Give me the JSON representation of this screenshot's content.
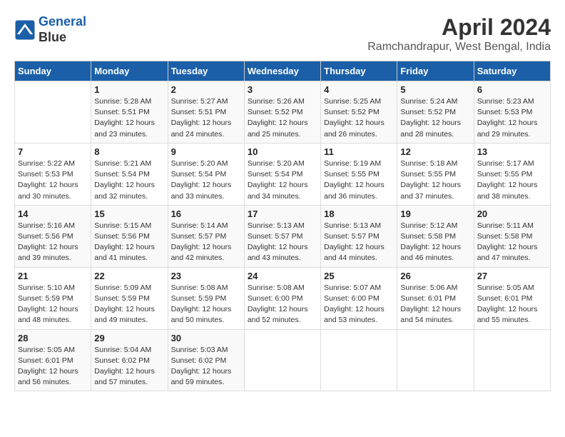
{
  "header": {
    "logo_line1": "General",
    "logo_line2": "Blue",
    "month_year": "April 2024",
    "location": "Ramchandrapur, West Bengal, India"
  },
  "weekdays": [
    "Sunday",
    "Monday",
    "Tuesday",
    "Wednesday",
    "Thursday",
    "Friday",
    "Saturday"
  ],
  "weeks": [
    [
      {
        "day": "",
        "info": ""
      },
      {
        "day": "1",
        "info": "Sunrise: 5:28 AM\nSunset: 5:51 PM\nDaylight: 12 hours\nand 23 minutes."
      },
      {
        "day": "2",
        "info": "Sunrise: 5:27 AM\nSunset: 5:51 PM\nDaylight: 12 hours\nand 24 minutes."
      },
      {
        "day": "3",
        "info": "Sunrise: 5:26 AM\nSunset: 5:52 PM\nDaylight: 12 hours\nand 25 minutes."
      },
      {
        "day": "4",
        "info": "Sunrise: 5:25 AM\nSunset: 5:52 PM\nDaylight: 12 hours\nand 26 minutes."
      },
      {
        "day": "5",
        "info": "Sunrise: 5:24 AM\nSunset: 5:52 PM\nDaylight: 12 hours\nand 28 minutes."
      },
      {
        "day": "6",
        "info": "Sunrise: 5:23 AM\nSunset: 5:53 PM\nDaylight: 12 hours\nand 29 minutes."
      }
    ],
    [
      {
        "day": "7",
        "info": "Sunrise: 5:22 AM\nSunset: 5:53 PM\nDaylight: 12 hours\nand 30 minutes."
      },
      {
        "day": "8",
        "info": "Sunrise: 5:21 AM\nSunset: 5:54 PM\nDaylight: 12 hours\nand 32 minutes."
      },
      {
        "day": "9",
        "info": "Sunrise: 5:20 AM\nSunset: 5:54 PM\nDaylight: 12 hours\nand 33 minutes."
      },
      {
        "day": "10",
        "info": "Sunrise: 5:20 AM\nSunset: 5:54 PM\nDaylight: 12 hours\nand 34 minutes."
      },
      {
        "day": "11",
        "info": "Sunrise: 5:19 AM\nSunset: 5:55 PM\nDaylight: 12 hours\nand 36 minutes."
      },
      {
        "day": "12",
        "info": "Sunrise: 5:18 AM\nSunset: 5:55 PM\nDaylight: 12 hours\nand 37 minutes."
      },
      {
        "day": "13",
        "info": "Sunrise: 5:17 AM\nSunset: 5:55 PM\nDaylight: 12 hours\nand 38 minutes."
      }
    ],
    [
      {
        "day": "14",
        "info": "Sunrise: 5:16 AM\nSunset: 5:56 PM\nDaylight: 12 hours\nand 39 minutes."
      },
      {
        "day": "15",
        "info": "Sunrise: 5:15 AM\nSunset: 5:56 PM\nDaylight: 12 hours\nand 41 minutes."
      },
      {
        "day": "16",
        "info": "Sunrise: 5:14 AM\nSunset: 5:57 PM\nDaylight: 12 hours\nand 42 minutes."
      },
      {
        "day": "17",
        "info": "Sunrise: 5:13 AM\nSunset: 5:57 PM\nDaylight: 12 hours\nand 43 minutes."
      },
      {
        "day": "18",
        "info": "Sunrise: 5:13 AM\nSunset: 5:57 PM\nDaylight: 12 hours\nand 44 minutes."
      },
      {
        "day": "19",
        "info": "Sunrise: 5:12 AM\nSunset: 5:58 PM\nDaylight: 12 hours\nand 46 minutes."
      },
      {
        "day": "20",
        "info": "Sunrise: 5:11 AM\nSunset: 5:58 PM\nDaylight: 12 hours\nand 47 minutes."
      }
    ],
    [
      {
        "day": "21",
        "info": "Sunrise: 5:10 AM\nSunset: 5:59 PM\nDaylight: 12 hours\nand 48 minutes."
      },
      {
        "day": "22",
        "info": "Sunrise: 5:09 AM\nSunset: 5:59 PM\nDaylight: 12 hours\nand 49 minutes."
      },
      {
        "day": "23",
        "info": "Sunrise: 5:08 AM\nSunset: 5:59 PM\nDaylight: 12 hours\nand 50 minutes."
      },
      {
        "day": "24",
        "info": "Sunrise: 5:08 AM\nSunset: 6:00 PM\nDaylight: 12 hours\nand 52 minutes."
      },
      {
        "day": "25",
        "info": "Sunrise: 5:07 AM\nSunset: 6:00 PM\nDaylight: 12 hours\nand 53 minutes."
      },
      {
        "day": "26",
        "info": "Sunrise: 5:06 AM\nSunset: 6:01 PM\nDaylight: 12 hours\nand 54 minutes."
      },
      {
        "day": "27",
        "info": "Sunrise: 5:05 AM\nSunset: 6:01 PM\nDaylight: 12 hours\nand 55 minutes."
      }
    ],
    [
      {
        "day": "28",
        "info": "Sunrise: 5:05 AM\nSunset: 6:01 PM\nDaylight: 12 hours\nand 56 minutes."
      },
      {
        "day": "29",
        "info": "Sunrise: 5:04 AM\nSunset: 6:02 PM\nDaylight: 12 hours\nand 57 minutes."
      },
      {
        "day": "30",
        "info": "Sunrise: 5:03 AM\nSunset: 6:02 PM\nDaylight: 12 hours\nand 59 minutes."
      },
      {
        "day": "",
        "info": ""
      },
      {
        "day": "",
        "info": ""
      },
      {
        "day": "",
        "info": ""
      },
      {
        "day": "",
        "info": ""
      }
    ]
  ]
}
